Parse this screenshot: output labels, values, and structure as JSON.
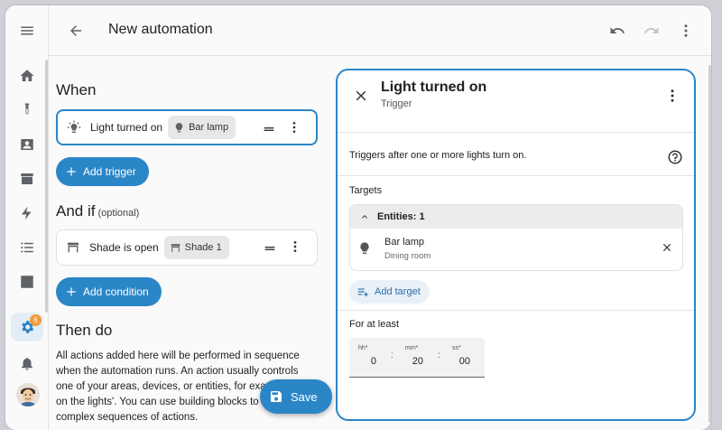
{
  "header": {
    "title": "New automation"
  },
  "sidebar": {
    "items": [
      {
        "icon": "home-icon"
      },
      {
        "icon": "test-tube-icon"
      },
      {
        "icon": "account-box-icon"
      },
      {
        "icon": "store-icon"
      },
      {
        "icon": "lightning-icon"
      },
      {
        "icon": "list-icon"
      },
      {
        "icon": "chart-icon"
      },
      {
        "icon": "gear-icon",
        "active": true,
        "badge": "6"
      },
      {
        "icon": "bell-icon"
      }
    ]
  },
  "when": {
    "heading": "When",
    "trigger": {
      "text": "Light turned on",
      "chip": "Bar lamp"
    },
    "add_button": "Add trigger"
  },
  "and_if": {
    "heading": "And if",
    "optional": "(optional)",
    "condition": {
      "text": "Shade is open",
      "chip": "Shade 1"
    },
    "add_button": "Add condition"
  },
  "then_do": {
    "heading": "Then do",
    "paragraph": "All actions added here will be performed in sequence when the automation runs. An action usually controls one of your areas, devices, or entities, for example 'turn on the lights'. You can use building blocks to create more complex sequences of actions."
  },
  "save_button": "Save",
  "panel": {
    "title": "Light turned on",
    "subtitle": "Trigger",
    "description": "Triggers after one or more lights turn on.",
    "targets_label": "Targets",
    "entities_header": "Entities: 1",
    "entity": {
      "name": "Bar lamp",
      "area": "Dining room"
    },
    "add_target": "Add target",
    "for_at_least_label": "For at least",
    "duration": {
      "hh_label": "hh*",
      "hh": "0",
      "mm_label": "mm*",
      "mm": "20",
      "ss_label": "ss*",
      "ss": "00",
      "sep": ":"
    }
  },
  "colors": {
    "accent": "#2b86c7",
    "badge": "#f29b38"
  }
}
